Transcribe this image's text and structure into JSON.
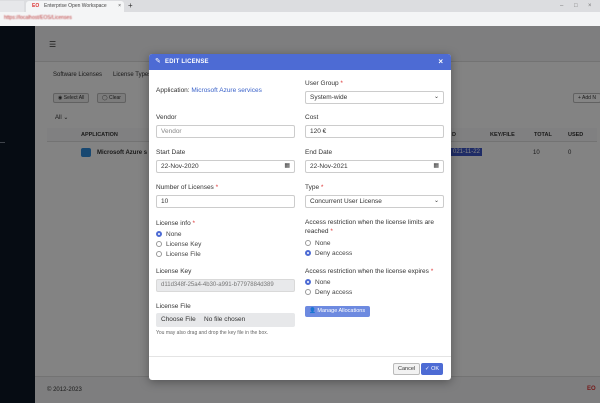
{
  "browser": {
    "tabs": [
      {
        "label": ""
      },
      {
        "label": "Enterprise Open Workspace",
        "favicon": "EO"
      }
    ],
    "new_tab": "+",
    "url": "https://localhost/EOS/Licenses"
  },
  "background": {
    "tabs": [
      "Software Licenses",
      "License Types"
    ],
    "select_all": "Select All",
    "clear": "Clear",
    "filter": "All",
    "add_new": "Add N",
    "columns": [
      "APPLICATION",
      "D",
      "KEY/FILE",
      "TOTAL",
      "USED"
    ],
    "row": {
      "application": "Microsoft Azure s",
      "end": "021-11-22",
      "total": "10",
      "used": "0"
    },
    "footer_copyright": "© 2012-2023",
    "footer_brand": "EO"
  },
  "modal": {
    "title": "EDIT LICENSE",
    "close": "×",
    "application_label": "Application:",
    "application_value": "Microsoft Azure services",
    "user_group": {
      "label": "User Group",
      "value": "System-wide"
    },
    "vendor": {
      "label": "Vendor",
      "placeholder": "Vendor"
    },
    "cost": {
      "label": "Cost",
      "value": "120 €"
    },
    "start_date": {
      "label": "Start Date",
      "value": "22-Nov-2020"
    },
    "end_date": {
      "label": "End Date",
      "value": "22-Nov-2021"
    },
    "num_licenses": {
      "label": "Number of Licenses",
      "value": "10"
    },
    "type": {
      "label": "Type",
      "value": "Concurrent User License"
    },
    "license_info": {
      "label": "License info",
      "options": [
        "None",
        "License Key",
        "License File"
      ],
      "selected": 0
    },
    "restriction_limits": {
      "label": "Access restriction when the license limits are reached",
      "options": [
        "None",
        "Deny access"
      ],
      "selected": 1
    },
    "license_key": {
      "label": "License Key",
      "value": "d11d348f-25a4-4b30-a991-b7797884d389"
    },
    "restriction_expires": {
      "label": "Access restriction when the license expires",
      "options": [
        "None",
        "Deny access"
      ],
      "selected": 0
    },
    "license_file": {
      "label": "License File",
      "choose": "Choose File",
      "no_file": "No file chosen",
      "hint": "You may also drag and drop the key file in the box."
    },
    "manage_allocations": "Manage Allocations",
    "cancel": "Cancel",
    "ok": "OK"
  }
}
